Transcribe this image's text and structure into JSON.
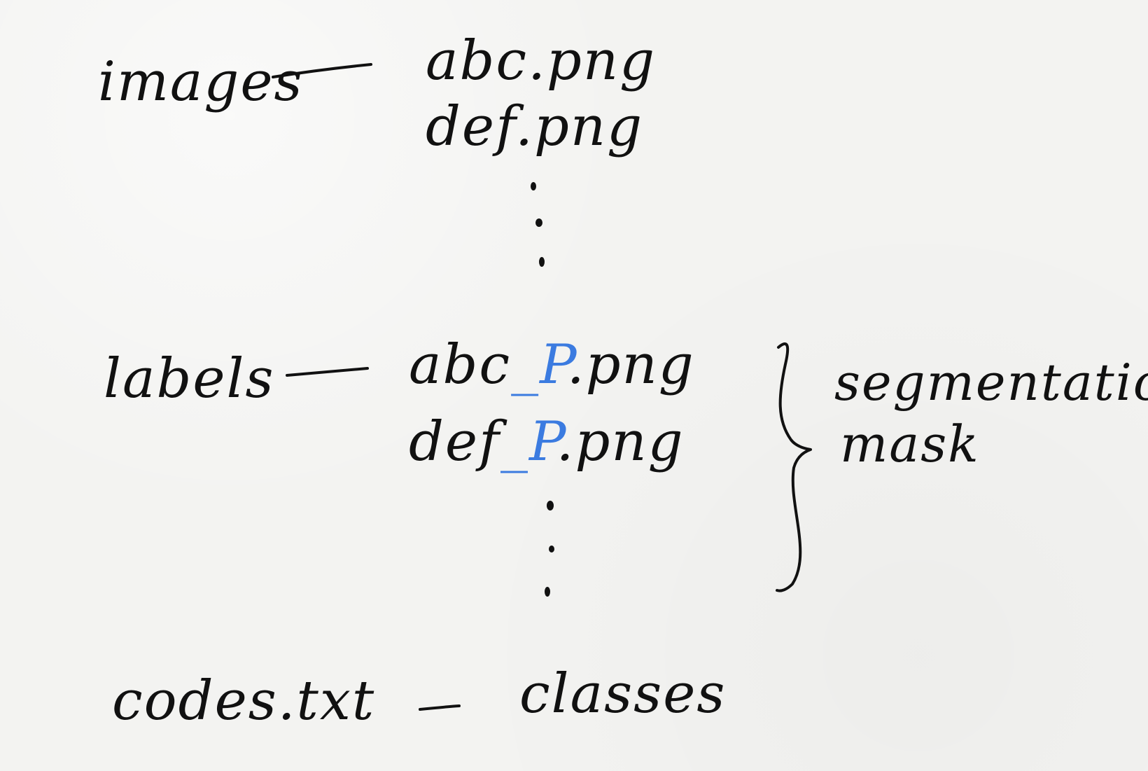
{
  "diagram": {
    "images": {
      "label": "images",
      "files": [
        "abc.png",
        "def.png"
      ]
    },
    "labels": {
      "label": "labels",
      "files": [
        {
          "prefix": "abc",
          "suffix": "_P",
          "ext": ".png"
        },
        {
          "prefix": "def",
          "suffix": "_P",
          "ext": ".png"
        }
      ],
      "annotation": [
        "segmentation",
        "mask"
      ]
    },
    "codes": {
      "label": "codes.txt",
      "target": "classes"
    },
    "colors": {
      "ink": "#111111",
      "accent": "#3b7be0",
      "paper": "#f3f3f1"
    }
  }
}
